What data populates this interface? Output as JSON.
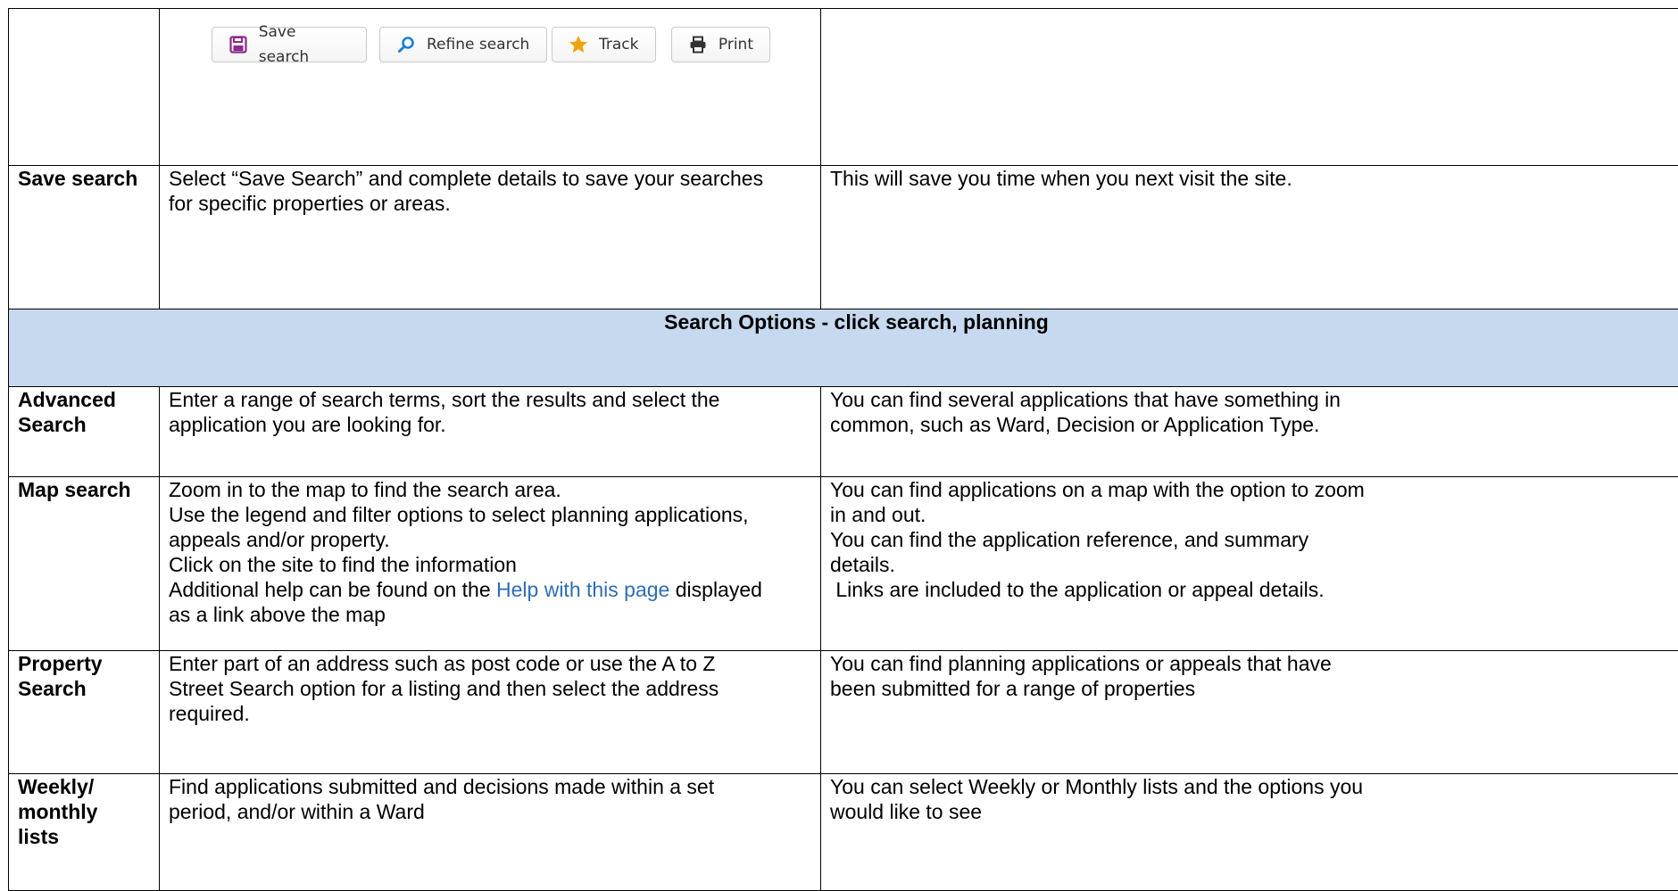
{
  "toolbar": {
    "save_label": "Save search",
    "refine_label": "Refine search",
    "track_label": "Track",
    "print_label": "Print",
    "icons": {
      "save": "floppy-disk-icon",
      "refine": "magnifier-icon",
      "track": "star-icon",
      "print": "printer-icon"
    },
    "colors": {
      "save_icon": "#8b2b8b",
      "refine_icon": "#1a7fd6",
      "track_icon": "#f2a20c",
      "print_icon": "#333333"
    }
  },
  "rows": {
    "save": {
      "label": "Save search",
      "description": [
        "Select “Save Search” and complete details to save your searches",
        "for specific properties or areas."
      ],
      "benefit": [
        "This will save you time when you next visit the site."
      ]
    },
    "heading": "Search Options - click search, planning",
    "advanced": {
      "label": [
        "Advanced",
        "Search"
      ],
      "description": [
        "Enter a range of search terms, sort the results and select the",
        "application you are looking for."
      ],
      "benefit": [
        "You can find several applications that have something in",
        "common, such as Ward, Decision or Application Type."
      ]
    },
    "map": {
      "label": "Map search",
      "description": [
        "Zoom in to the map to find the search area.",
        "Use the legend and filter options to select planning applications,",
        "appeals and/or property.",
        "Click on the site to find the information"
      ],
      "description_help_prefix": "Additional help can be found on the ",
      "description_help_link": "Help with this page",
      "description_help_suffix": " displayed",
      "description_last": "as a link above the map",
      "benefit": [
        "You can find applications on a map with the option to zoom",
        "in and out.",
        "You can find the application reference, and summary",
        "details.",
        " Links are included to the application or appeal details."
      ]
    },
    "property": {
      "label": [
        "Property",
        "Search"
      ],
      "description": [
        "Enter part of an address such as post code or use the A to Z",
        "Street Search option for a listing and then select the address",
        "required."
      ],
      "benefit": [
        "You can find planning applications or appeals that have",
        "been submitted for a range of properties"
      ]
    },
    "weekly": {
      "label": [
        "Weekly/",
        "monthly",
        "lists"
      ],
      "description": [
        "Find applications submitted and decisions made within a set",
        "period, and/or within a Ward"
      ],
      "benefit": [
        "You can select Weekly or Monthly lists and the options you",
        "would like to see"
      ]
    }
  },
  "colors": {
    "heading_bg": "#c6d9ef",
    "link": "#2e6db4"
  }
}
